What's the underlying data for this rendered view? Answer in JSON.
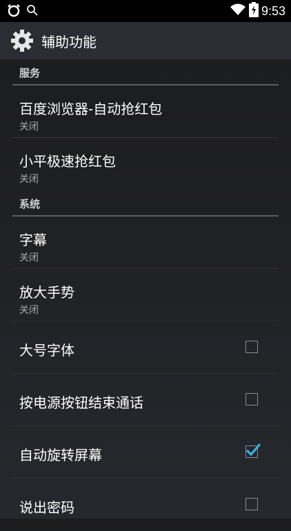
{
  "status_bar": {
    "time": "9:53",
    "left_icons": [
      "alarm-clock-icon",
      "search-icon"
    ],
    "right_icons": [
      "wifi-icon",
      "battery-charging-icon"
    ]
  },
  "action_bar": {
    "icon": "settings-gear-icon",
    "title": "辅助功能"
  },
  "sections": [
    {
      "header": "服务",
      "items": [
        {
          "title": "百度浏览器-自动抢红包",
          "summary": "关闭"
        },
        {
          "title": "小平极速抢红包",
          "summary": "关闭"
        }
      ]
    },
    {
      "header": "系统",
      "items": [
        {
          "title": "字幕",
          "summary": "关闭"
        },
        {
          "title": "放大手势",
          "summary": "关闭"
        },
        {
          "title": "大号字体",
          "checked": false
        },
        {
          "title": "按电源按钮结束通话",
          "checked": false
        },
        {
          "title": "自动旋转屏幕",
          "checked": true
        },
        {
          "title": "说出密码",
          "checked": false
        }
      ]
    }
  ],
  "colors": {
    "accent": "#33b5e5",
    "background": "#1b1d1f",
    "action_bar": "#2a2d31"
  }
}
